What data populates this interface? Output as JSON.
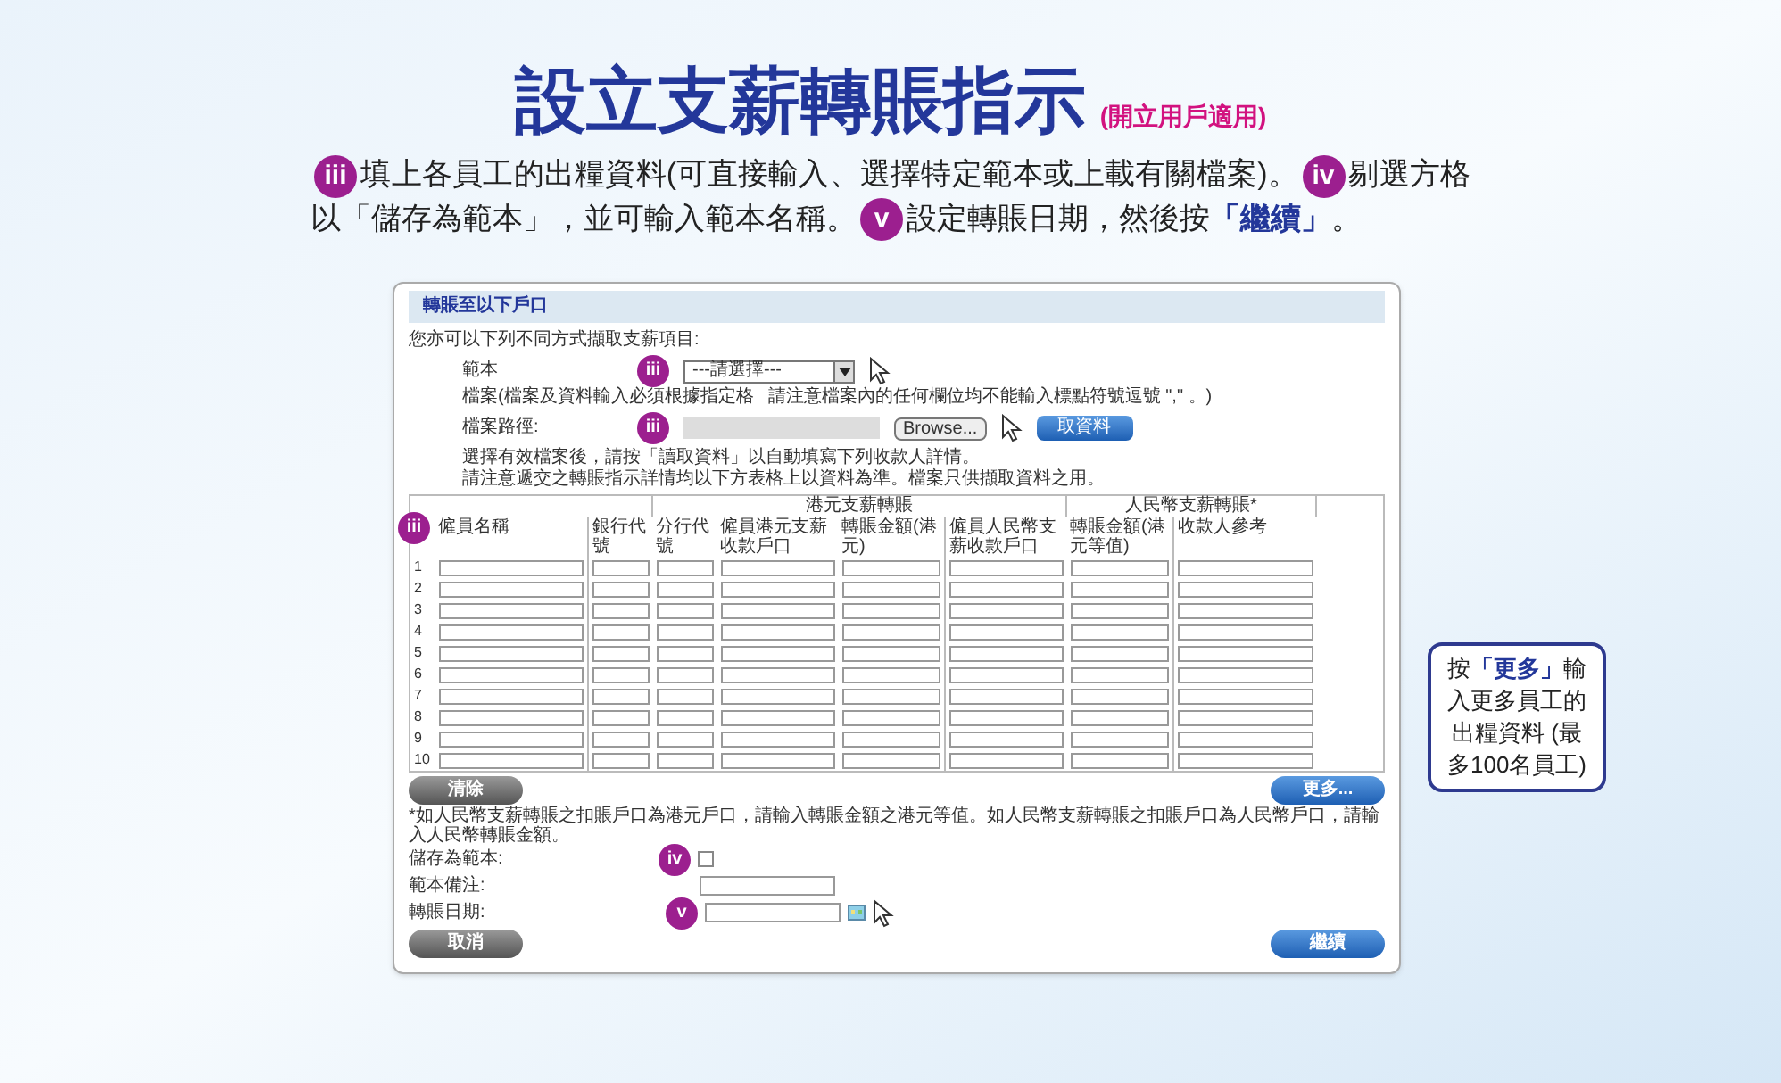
{
  "title": "設立支薪轉賬指示",
  "title_note": "(開立用戶適用)",
  "instructions": [
    {
      "kind": "badge",
      "text": "iii"
    },
    {
      "kind": "text",
      "text": "填上各員工的出糧資料(可直接輸入、選擇特定範本或上載有關檔案)。"
    },
    {
      "kind": "badge",
      "text": "iv"
    },
    {
      "kind": "text",
      "text": "剔選方格以「儲存為範本」，並可輸入範本名稱。"
    },
    {
      "kind": "badge",
      "text": "v"
    },
    {
      "kind": "text",
      "text": "設定轉賬日期，然後按"
    },
    {
      "kind": "emphasis",
      "text": "「繼續」"
    },
    {
      "kind": "text",
      "text": "。"
    }
  ],
  "form": {
    "section_title": "轉賬至以下戶口",
    "intro": "您亦可以下列不同方式擷取支薪項目:",
    "template": {
      "label": "範本",
      "badge": "iii",
      "value": "---請選擇---"
    },
    "file_note_parts": [
      "檔案(檔案及資料輸入必須根據指定格",
      "請注意檔案內的任何欄位均不能輸入標點符號逗號 \",\" 。)"
    ],
    "file_path": {
      "label": "檔案路徑:",
      "badge": "iii",
      "browse": "Browse...",
      "read_button": "取資料"
    },
    "info_lines": [
      "選擇有效檔案後，請按「讀取資料」以自動填寫下列收款人詳情。",
      "請注意遞交之轉賬指示詳情均以下方表格上以資料為準。檔案只供擷取資料之用。"
    ],
    "table": {
      "name_badge": "iii",
      "groups": [
        "港元支薪轉賬",
        "人民幣支薪轉賬*"
      ],
      "columns": [
        "僱員名稱",
        "銀行代號",
        "分行代號",
        "僱員港元支薪收款戶口",
        "轉賬金額(港元)",
        "僱員人民幣支薪收款戶口",
        "轉賬金額(港元等值)",
        "收款人參考"
      ],
      "rows": [
        "1",
        "2",
        "3",
        "4",
        "5",
        "6",
        "7",
        "8",
        "9",
        "10"
      ]
    },
    "clear_button": "清除",
    "more_button": "更多...",
    "note": "*如人民幣支薪轉賬之扣賬戶口為港元戶口，請輸入轉賬金額之港元等值。如人民幣支薪轉賬之扣賬戶口為人民幣戶口，請輸入人民幣轉賬金額。",
    "save_template": {
      "label": "儲存為範本:",
      "badge": "iv",
      "checked": false
    },
    "template_remark": {
      "label": "範本備注:"
    },
    "transfer_date": {
      "label": "轉賬日期:",
      "badge": "v"
    },
    "cancel_button": "取消",
    "continue_button": "繼續"
  },
  "callout": [
    {
      "kind": "text",
      "text": "按"
    },
    {
      "kind": "emphasis",
      "text": "「更多」"
    },
    {
      "kind": "text",
      "text": "輸入更多員工的出糧資料 (最多100名員工)"
    }
  ]
}
